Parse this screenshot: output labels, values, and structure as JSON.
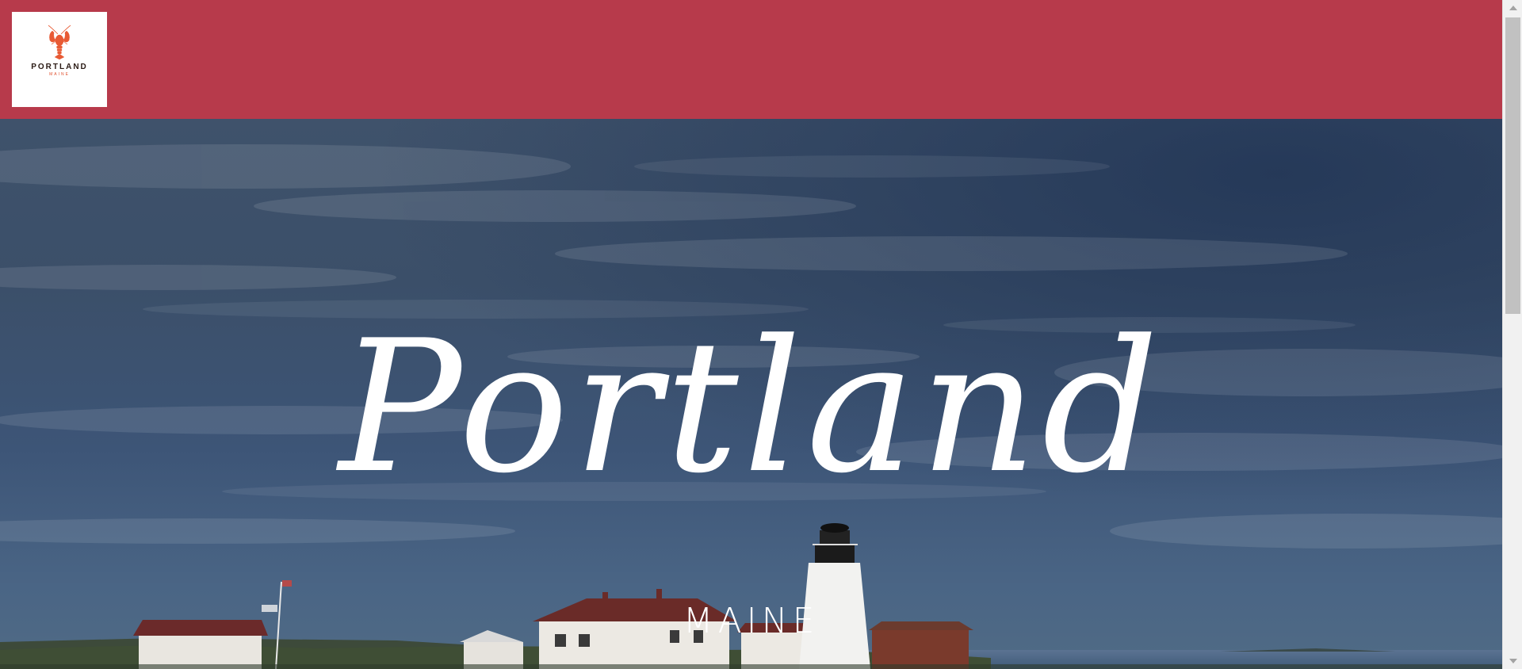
{
  "logo": {
    "title": "PORTLAND",
    "subtitle": "MAINE",
    "icon": "lobster-icon",
    "lobster_color": "#e85a34"
  },
  "header": {
    "background_color": "#b73a4b"
  },
  "hero": {
    "title": "Portland",
    "subtitle": "MAINE"
  },
  "scrollbar": {
    "up_icon": "chevron-up-icon",
    "down_icon": "chevron-down-icon"
  }
}
